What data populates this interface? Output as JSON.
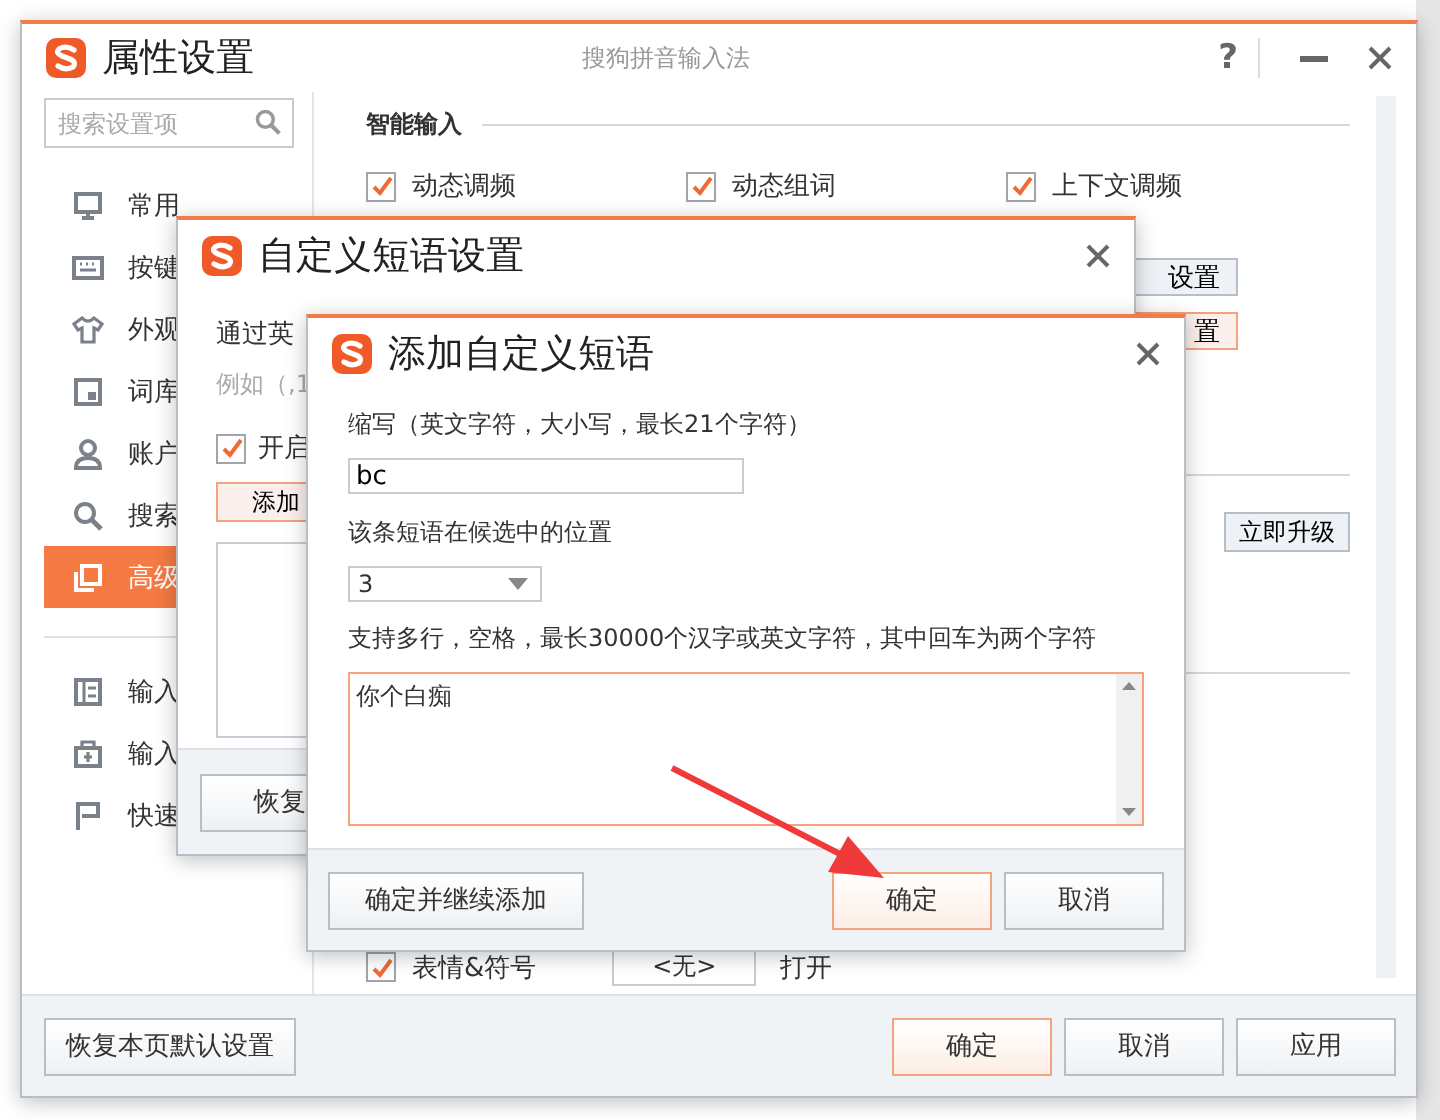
{
  "main_window": {
    "title": "属性设置",
    "subtitle": "搜狗拼音输入法",
    "help": "?",
    "search": {
      "placeholder": "搜索设置项"
    },
    "sidebar": {
      "items": [
        {
          "label": "常用",
          "selected": false
        },
        {
          "label": "按键",
          "selected": false
        },
        {
          "label": "外观",
          "selected": false
        },
        {
          "label": "词库",
          "selected": false
        },
        {
          "label": "账户",
          "selected": false
        },
        {
          "label": "搜索",
          "selected": false
        },
        {
          "label": "高级",
          "selected": true
        }
      ],
      "tools": [
        {
          "label": "输入"
        },
        {
          "label": "输入"
        },
        {
          "label": "快速"
        }
      ]
    },
    "section": {
      "title": "智能输入",
      "options": [
        {
          "label": "动态调频",
          "checked": true
        },
        {
          "label": "动态组词",
          "checked": true
        },
        {
          "label": "上下文调频",
          "checked": true
        }
      ]
    },
    "partial_buttons": [
      {
        "label": "设置",
        "highlighted": false
      },
      {
        "label": "置",
        "highlighted": true
      }
    ],
    "upgrade_button": "立即升级",
    "emoji_row": {
      "label": "表情&符号",
      "checked": true,
      "hotkey": "<无>",
      "action": "打开"
    },
    "footer": {
      "restore": "恢复本页默认设置",
      "buttons": [
        {
          "label": "确定",
          "primary": true
        },
        {
          "label": "取消",
          "primary": false
        },
        {
          "label": "应用",
          "primary": false
        }
      ]
    }
  },
  "phrase_dialog": {
    "title": "自定义短语设置",
    "intro": "通过英",
    "example": "例如（,1",
    "enable": {
      "label": "开启",
      "checked": true
    },
    "add_button": "添加",
    "restore_button": "恢复"
  },
  "add_dialog": {
    "title": "添加自定义短语",
    "abbr_label": "缩写（英文字符，大小写，最长21个字符）",
    "abbr_value": "bc",
    "position_label": "该条短语在候选中的位置",
    "position_value": "3",
    "phrase_label": "支持多行，空格，最长30000个汉字或英文字符，其中回车为两个字符",
    "phrase_value": "你个白痴",
    "buttons": [
      {
        "label": "确定并继续添加",
        "primary": false
      },
      {
        "label": "确定",
        "primary": true
      },
      {
        "label": "取消",
        "primary": false
      }
    ]
  }
}
